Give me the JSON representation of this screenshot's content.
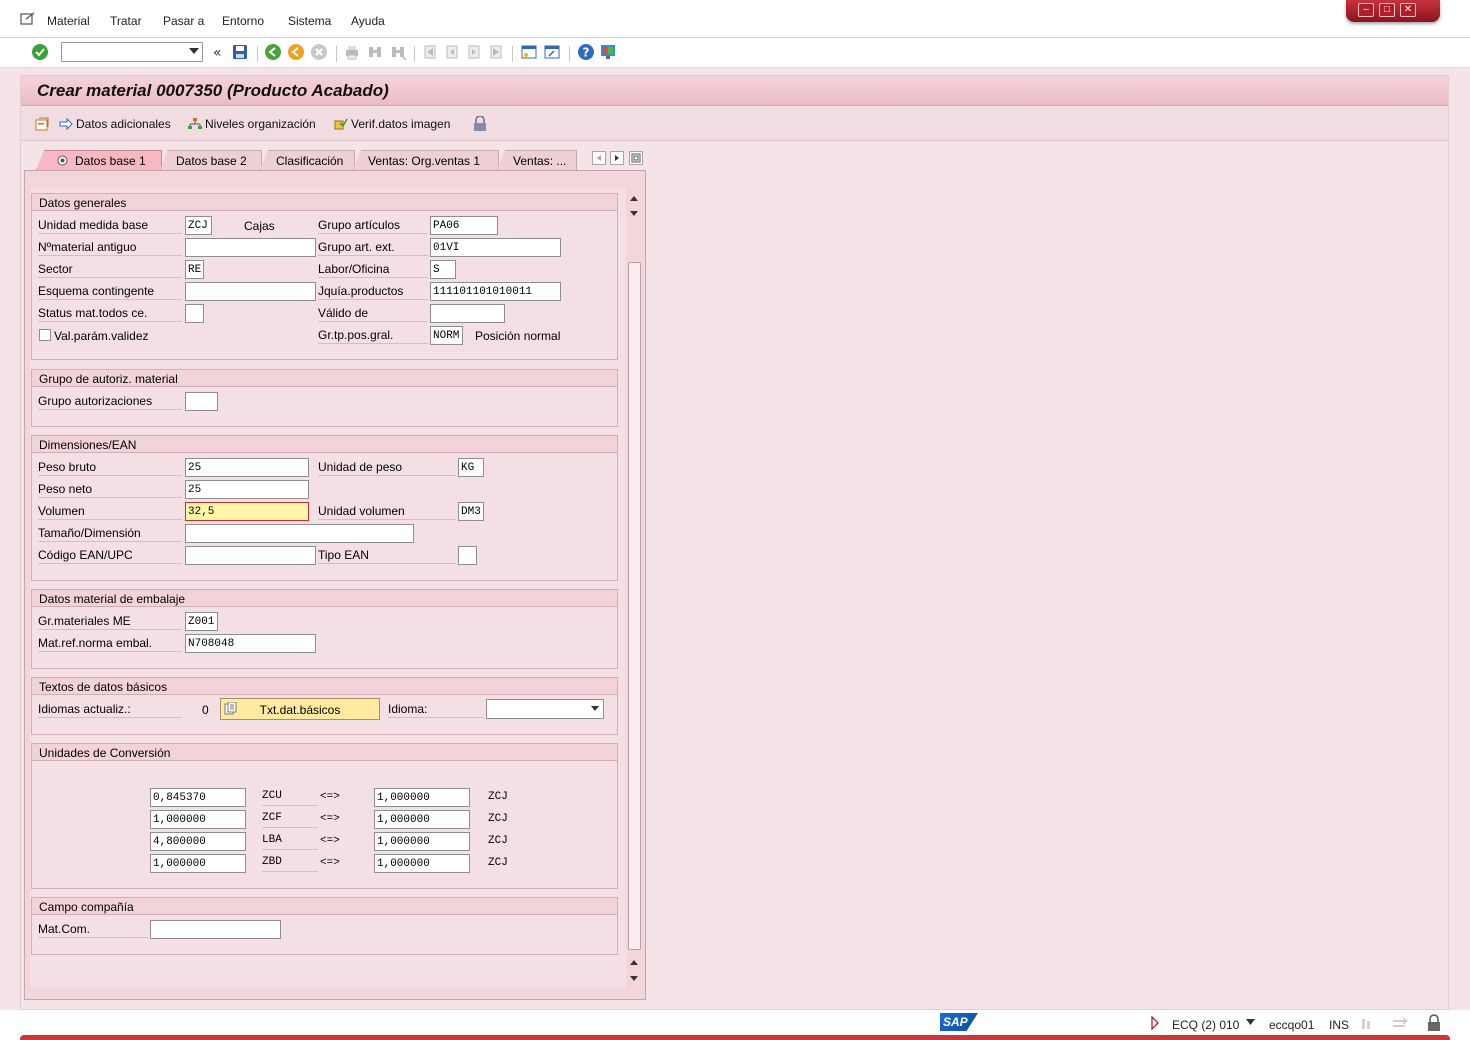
{
  "menu": {
    "items": [
      "Material",
      "Tratar",
      "Pasar a",
      "Entorno",
      "Sistema",
      "Ayuda"
    ]
  },
  "window": {
    "controls": [
      "minimize-icon",
      "maximize-icon",
      "close-icon"
    ]
  },
  "title": "Crear material 0007350 (Producto Acabado)",
  "app_toolbar": {
    "datos_adicionales": "Datos adicionales",
    "niveles_organizacion": "Niveles organización",
    "verif_datos_imagen": "Verif.datos imagen"
  },
  "tabs": {
    "active": "Datos base 1",
    "items": [
      "Datos base 1",
      "Datos base 2",
      "Clasificación",
      "Ventas: Org.ventas 1",
      "Ventas: ..."
    ]
  },
  "datos_generales": {
    "title": "Datos generales",
    "unidad_medida_base": {
      "label": "Unidad medida base",
      "value": "ZCJ",
      "text": "Cajas"
    },
    "grupo_articulos": {
      "label": "Grupo artículos",
      "value": "PA06"
    },
    "n_material_antiguo": {
      "label": "Nºmaterial antiguo",
      "value": ""
    },
    "grupo_art_ext": {
      "label": "Grupo art. ext.",
      "value": "01VI"
    },
    "sector": {
      "label": "Sector",
      "value": "RE"
    },
    "labor_oficina": {
      "label": "Labor/Oficina",
      "value": "S"
    },
    "esquema_contingente": {
      "label": "Esquema contingente",
      "value": ""
    },
    "jquia_productos": {
      "label": "Jquía.productos",
      "value": "111101101010011"
    },
    "status_mat": {
      "label": "Status mat.todos ce.",
      "value": ""
    },
    "valido_de": {
      "label": "Válido de",
      "value": ""
    },
    "val_param_validez": {
      "label": "Val.parám.validez",
      "checked": false
    },
    "gr_tp_pos_gral": {
      "label": "Gr.tp.pos.gral.",
      "value": "NORM",
      "text": "Posición normal"
    }
  },
  "grupo_autoriz": {
    "title": "Grupo de autoriz. material",
    "grupo_autorizaciones": {
      "label": "Grupo autorizaciones",
      "value": ""
    }
  },
  "dimensiones": {
    "title": "Dimensiones/EAN",
    "peso_bruto": {
      "label": "Peso bruto",
      "value": "25"
    },
    "unidad_peso": {
      "label": "Unidad de peso",
      "value": "KG"
    },
    "peso_neto": {
      "label": "Peso neto",
      "value": "25"
    },
    "volumen": {
      "label": "Volumen",
      "value": "32,5"
    },
    "unidad_volumen": {
      "label": "Unidad volumen",
      "value": "DM3"
    },
    "tamano_dimension": {
      "label": "Tamaño/Dimensión",
      "value": ""
    },
    "codigo_ean": {
      "label": "Código EAN/UPC",
      "value": ""
    },
    "tipo_ean": {
      "label": "Tipo EAN",
      "value": ""
    }
  },
  "embalaje": {
    "title": "Datos material de embalaje",
    "gr_materiales_me": {
      "label": "Gr.materiales ME",
      "value": "Z001"
    },
    "mat_ref_norma": {
      "label": "Mat.ref.norma embal.",
      "value": "N708048"
    }
  },
  "textos": {
    "title": "Textos de datos básicos",
    "idiomas_actualiz": {
      "label": "Idiomas actualiz.:",
      "value": "0"
    },
    "txt_button": "Txt.dat.básicos",
    "idioma": {
      "label": "Idioma:",
      "value": ""
    }
  },
  "conversion": {
    "title": "Unidades de Conversión",
    "rows": [
      {
        "qty": "0,845370",
        "unit": "ZCU",
        "arrow": "<=>",
        "base_qty": "1,000000",
        "base_unit": "ZCJ"
      },
      {
        "qty": "1,000000",
        "unit": "ZCF",
        "arrow": "<=>",
        "base_qty": "1,000000",
        "base_unit": "ZCJ"
      },
      {
        "qty": "4,800000",
        "unit": "LBA",
        "arrow": "<=>",
        "base_qty": "1,000000",
        "base_unit": "ZCJ"
      },
      {
        "qty": "1,000000",
        "unit": "ZBD",
        "arrow": "<=>",
        "base_qty": "1,000000",
        "base_unit": "ZCJ"
      }
    ]
  },
  "campo_compania": {
    "title": "Campo compañía",
    "mat_com": {
      "label": "Mat.Com.",
      "value": ""
    }
  },
  "status": {
    "system": "ECQ (2) 010",
    "server": "eccqo01",
    "mode": "INS",
    "logo": "SAP"
  },
  "colors": {
    "background": "#f4e4e8",
    "title_bar": "#ebbcc6",
    "active_tab": "#f7b8c4",
    "focus_field": "#fff6a8",
    "button": "#ffeba0",
    "window_controls": "#b01e2a"
  }
}
